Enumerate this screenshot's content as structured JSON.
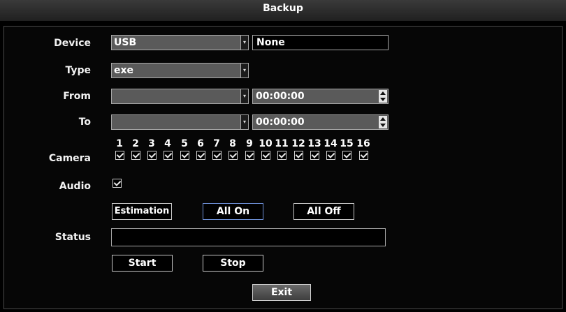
{
  "window": {
    "title": "Backup"
  },
  "labels": {
    "device": "Device",
    "type": "Type",
    "from": "From",
    "to": "To",
    "camera": "Camera",
    "audio": "Audio",
    "status": "Status"
  },
  "device": {
    "select_value": "USB",
    "info": "None"
  },
  "type": {
    "select_value": "exe"
  },
  "from": {
    "date_value": "",
    "time_value": "00:00:00"
  },
  "to": {
    "date_value": "",
    "time_value": "00:00:00"
  },
  "cameras": [
    "1",
    "2",
    "3",
    "4",
    "5",
    "6",
    "7",
    "8",
    "9",
    "10",
    "11",
    "12",
    "13",
    "14",
    "15",
    "16"
  ],
  "camera_checked": [
    true,
    true,
    true,
    true,
    true,
    true,
    true,
    true,
    true,
    true,
    true,
    true,
    true,
    true,
    true,
    true
  ],
  "audio_checked": true,
  "buttons": {
    "estimation": "Estimation",
    "all_on": "All On",
    "all_off": "All Off",
    "start": "Start",
    "stop": "Stop",
    "exit": "Exit"
  },
  "status": {
    "value": ""
  },
  "icons": {
    "dropdown": "chevron-down-icon",
    "spinner": "spin-updown-icon",
    "check": "checkbox-checked-icon"
  }
}
